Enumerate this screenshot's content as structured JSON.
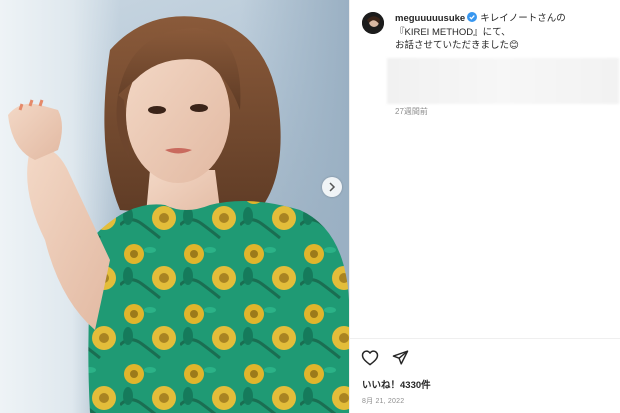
{
  "post": {
    "username": "meguuuuusuke",
    "caption_line1": "キレイノートさんの",
    "caption_line2": "『KIREI METHOD』にて、",
    "caption_line3": "お話させていただきました😊",
    "caption_time": "27週間前",
    "likes": "いいね！4330件",
    "date": "8月 21, 2022"
  },
  "icons": {
    "verified": "verified-badge-icon",
    "like": "heart-icon",
    "share": "paper-plane-icon",
    "next": "chevron-right-icon"
  },
  "colors": {
    "verified_blue": "#3897f0",
    "dress_green": "#1f9a74",
    "dress_yellow": "#e0b52c",
    "text": "#262626",
    "muted": "#8e8e8e"
  }
}
